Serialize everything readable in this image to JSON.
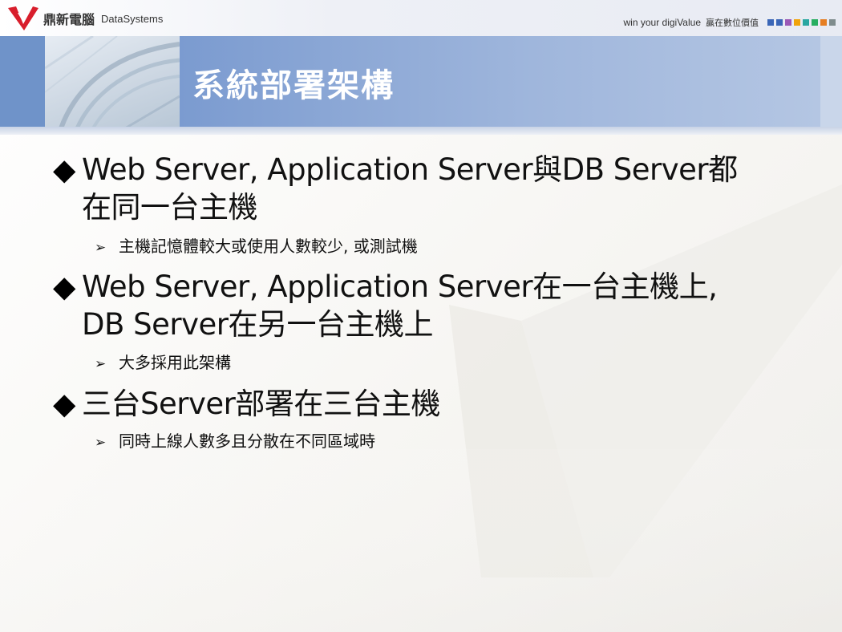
{
  "header": {
    "logo_cn": "鼎新電腦",
    "logo_en": "DataSystems",
    "slogan_en": "win your digiValue",
    "slogan_cn": "贏在數位價值",
    "square_colors": [
      "#3a66b7",
      "#3a66b7",
      "#9b59b6",
      "#f0a30a",
      "#2aa7a1",
      "#27ae60",
      "#e67e22",
      "#7f8c8d"
    ]
  },
  "title": "系統部署架構",
  "bullets": [
    {
      "line1": "Web Server, Application Server與DB Server都",
      "line2": "在同一台主機",
      "sub": "主機記憶體較大或使用人數較少, 或測試機"
    },
    {
      "line1": "Web Server, Application Server在一台主機上,",
      "line2": "DB Server在另一台主機上",
      "sub": "大多採用此架構"
    },
    {
      "line1": "三台Server部署在三台主機",
      "line2": "",
      "sub": "同時上線人數多且分散在不同區域時"
    }
  ],
  "symbols": {
    "diamond": "◆",
    "arrow": "➢"
  },
  "colors": {
    "title_band": "#a9c0e0",
    "accent_blue": "#6f93c9",
    "logo_red": "#d81e2c"
  }
}
